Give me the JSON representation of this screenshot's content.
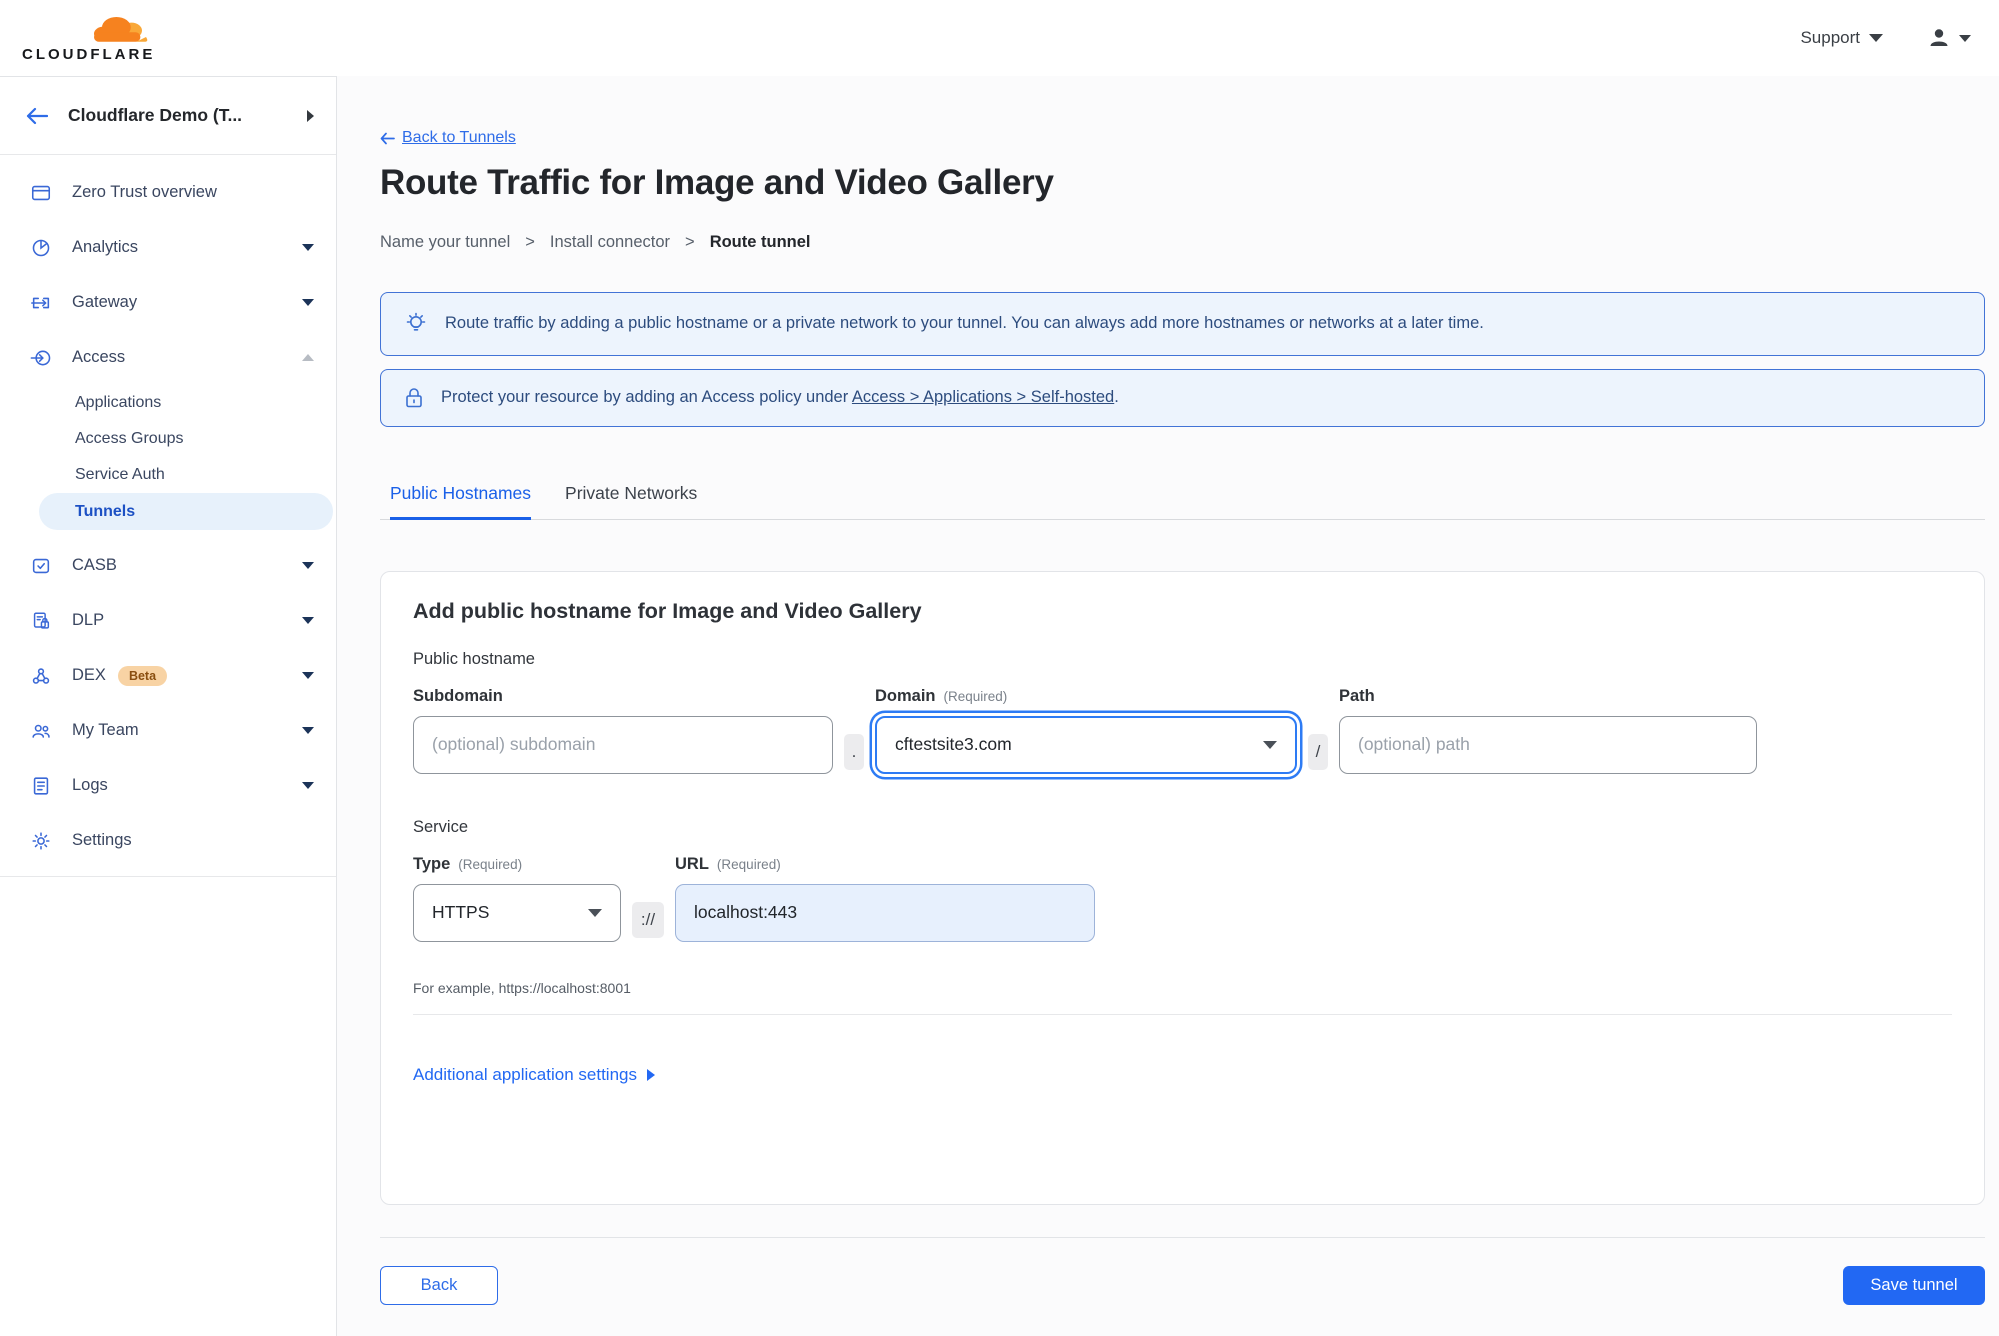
{
  "header": {
    "logo_text": "CLOUDFLARE",
    "support_label": "Support"
  },
  "sidebar": {
    "account_name": "Cloudflare Demo (T...",
    "nav": [
      {
        "label": "Zero Trust overview"
      },
      {
        "label": "Analytics"
      },
      {
        "label": "Gateway"
      },
      {
        "label": "Access"
      },
      {
        "label": "CASB"
      },
      {
        "label": "DLP"
      },
      {
        "label": "DEX",
        "badge": "Beta"
      },
      {
        "label": "My Team"
      },
      {
        "label": "Logs"
      },
      {
        "label": "Settings"
      }
    ],
    "access_children": [
      {
        "label": "Applications"
      },
      {
        "label": "Access Groups"
      },
      {
        "label": "Service Auth"
      },
      {
        "label": "Tunnels",
        "active": true
      }
    ]
  },
  "page": {
    "back_label": "Back to Tunnels",
    "title": "Route Traffic for Image and Video Gallery",
    "breadcrumb": {
      "step1": "Name your tunnel",
      "sep": ">",
      "step2": "Install connector",
      "step3": "Route tunnel"
    },
    "banners": {
      "tip": "Route traffic by adding a public hostname or a private network to your tunnel. You can always add more hostnames or networks at a later time.",
      "protect_prefix": "Protect your resource by adding an Access policy under",
      "protect_link": "Access > Applications > Self-hosted",
      "protect_suffix": "."
    },
    "tabs": {
      "public": "Public Hostnames",
      "private": "Private Networks"
    },
    "form": {
      "heading": "Add public hostname for Image and Video Gallery",
      "public_hostname_label": "Public hostname",
      "subdomain_label": "Subdomain",
      "subdomain_placeholder": "(optional) subdomain",
      "dot_separator": ".",
      "domain_label": "Domain",
      "required_note": "(Required)",
      "domain_value": "cftestsite3.com",
      "slash_separator": "/",
      "path_label": "Path",
      "path_placeholder": "(optional) path",
      "service_label": "Service",
      "type_label": "Type",
      "type_value": "HTTPS",
      "scheme_separator": "://",
      "url_label": "URL",
      "url_value": "localhost:443",
      "example_text": "For example, https://localhost:8001",
      "additional_settings": "Additional application settings"
    },
    "footer": {
      "back": "Back",
      "save": "Save tunnel"
    }
  },
  "colors": {
    "accent_blue": "#2268f3",
    "banner_border": "#4273d6",
    "banner_bg": "#edf4fd",
    "banner_text": "#2d4c7e",
    "active_pill_bg": "#e7f1fb",
    "active_pill_text": "#1d51c4",
    "logo_orange": "#f6821f",
    "logo_orange_light": "#f9a838",
    "beta_badge_bg": "#f8d3a4",
    "beta_badge_text": "#8a4f10"
  }
}
